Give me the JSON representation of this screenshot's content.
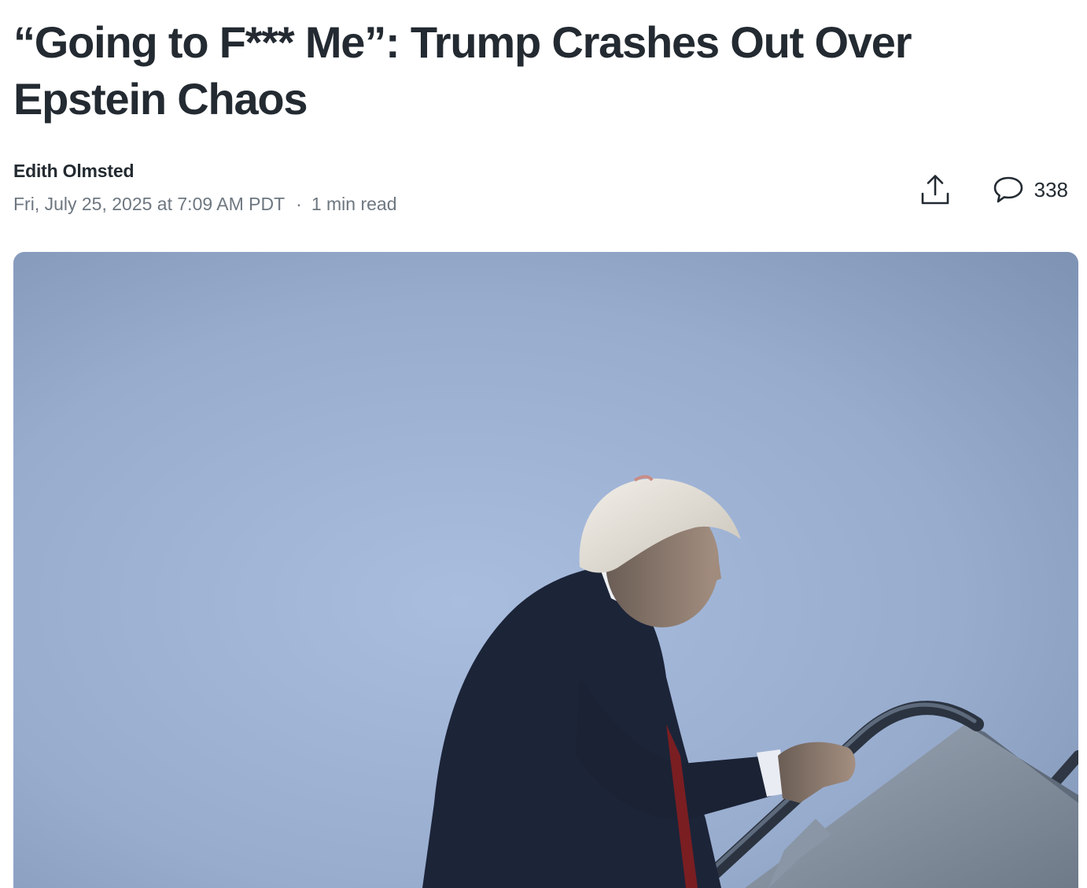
{
  "article": {
    "headline": "“Going to F*** Me”: Trump Crashes Out Over Epstein Chaos",
    "author": "Edith Olmsted",
    "published": "Fri, July 25, 2025 at 7:09 AM PDT",
    "separator": "·",
    "read_time": "1 min read"
  },
  "actions": {
    "share_icon": "share-icon",
    "comment_icon": "comment-icon",
    "comment_count": "338"
  },
  "hero_image": {
    "subject": "photo"
  }
}
